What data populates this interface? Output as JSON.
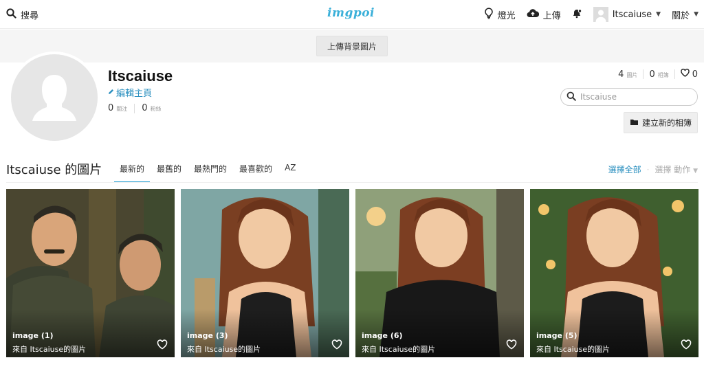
{
  "nav": {
    "search_label": "搜尋",
    "logo": "imgpoi",
    "light_label": "燈光",
    "upload_label": "上傳",
    "user_label": "Itscaiuse",
    "about_label": "關於"
  },
  "banner": {
    "upload_bg_label": "上傳背景圖片"
  },
  "profile": {
    "username": "Itscaiuse",
    "edit_label": "編輯主頁",
    "following_count": "0",
    "following_label": "關注",
    "followers_count": "0",
    "followers_label": "粉絲",
    "images_count": "4",
    "images_label": "圖片",
    "albums_count": "0",
    "albums_label": "相簿",
    "likes_count": "0",
    "search_placeholder": "Itscaiuse",
    "create_album_label": "建立新的相簿"
  },
  "gallery": {
    "title": "Itscaiuse 的圖片",
    "tabs": [
      "最新的",
      "最舊的",
      "最熱門的",
      "最喜歡的",
      "AZ"
    ],
    "active_tab": 0,
    "select_all": "選擇全部",
    "select_action": "選擇 動作"
  },
  "images": [
    {
      "title": "image (1)",
      "subtitle": "來自 Itscaiuse的圖片"
    },
    {
      "title": "image (3)",
      "subtitle": "來自 Itscaiuse的圖片"
    },
    {
      "title": "image (6)",
      "subtitle": "來自 Itscaiuse的圖片"
    },
    {
      "title": "image (5)",
      "subtitle": "來自 Itscaiuse的圖片"
    }
  ],
  "colors": {
    "accent": "#3aa7d6",
    "link": "#2a8fbf",
    "banner_bg": "#f5f5f5"
  }
}
